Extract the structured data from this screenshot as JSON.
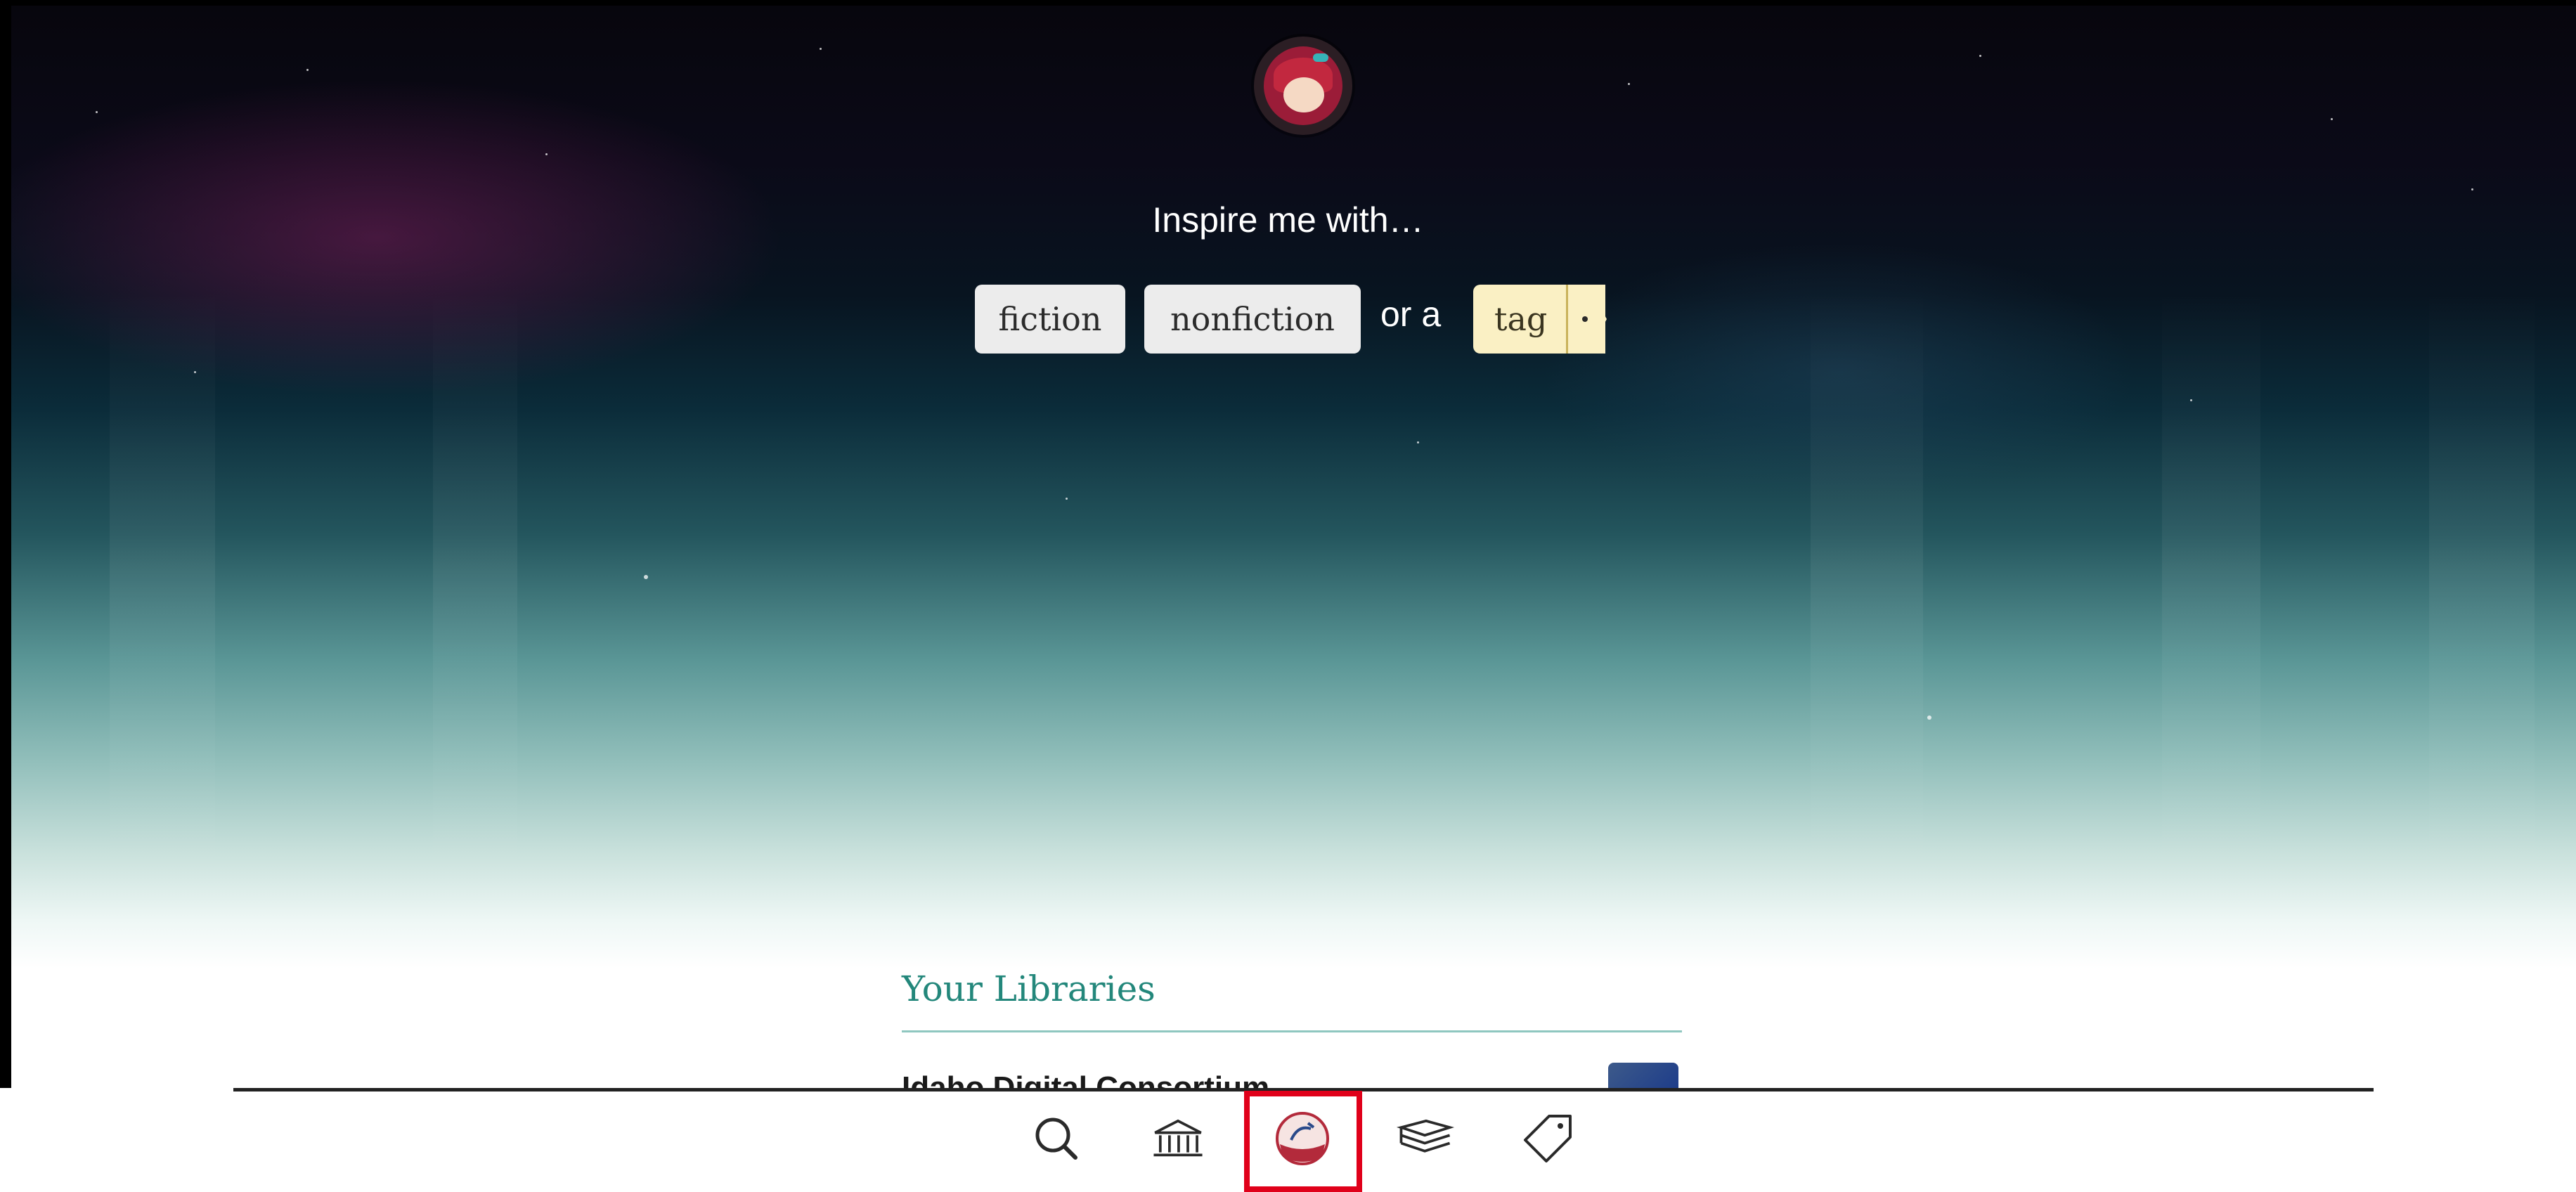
{
  "header": {
    "logo_icon": "libby-logo-icon",
    "inspire_text": "Inspire me with…"
  },
  "inspire_options": {
    "fiction": "fiction",
    "nonfiction": "nonfiction",
    "or_a": "or a",
    "tag": "tag"
  },
  "libraries": {
    "heading": "Your Libraries",
    "items": [
      {
        "name": "Idaho Digital Consortium"
      }
    ]
  },
  "nav": {
    "items": [
      {
        "icon": "search-icon",
        "selected": false
      },
      {
        "icon": "library-icon",
        "selected": false
      },
      {
        "icon": "libby-home-icon",
        "selected": true
      },
      {
        "icon": "shelf-icon",
        "selected": false
      },
      {
        "icon": "tag-icon",
        "selected": false
      }
    ]
  },
  "colors": {
    "accent_teal": "#23877b",
    "selected_border": "#e0001a",
    "tag_chip": "#faf0c4",
    "chip": "#ececec"
  }
}
